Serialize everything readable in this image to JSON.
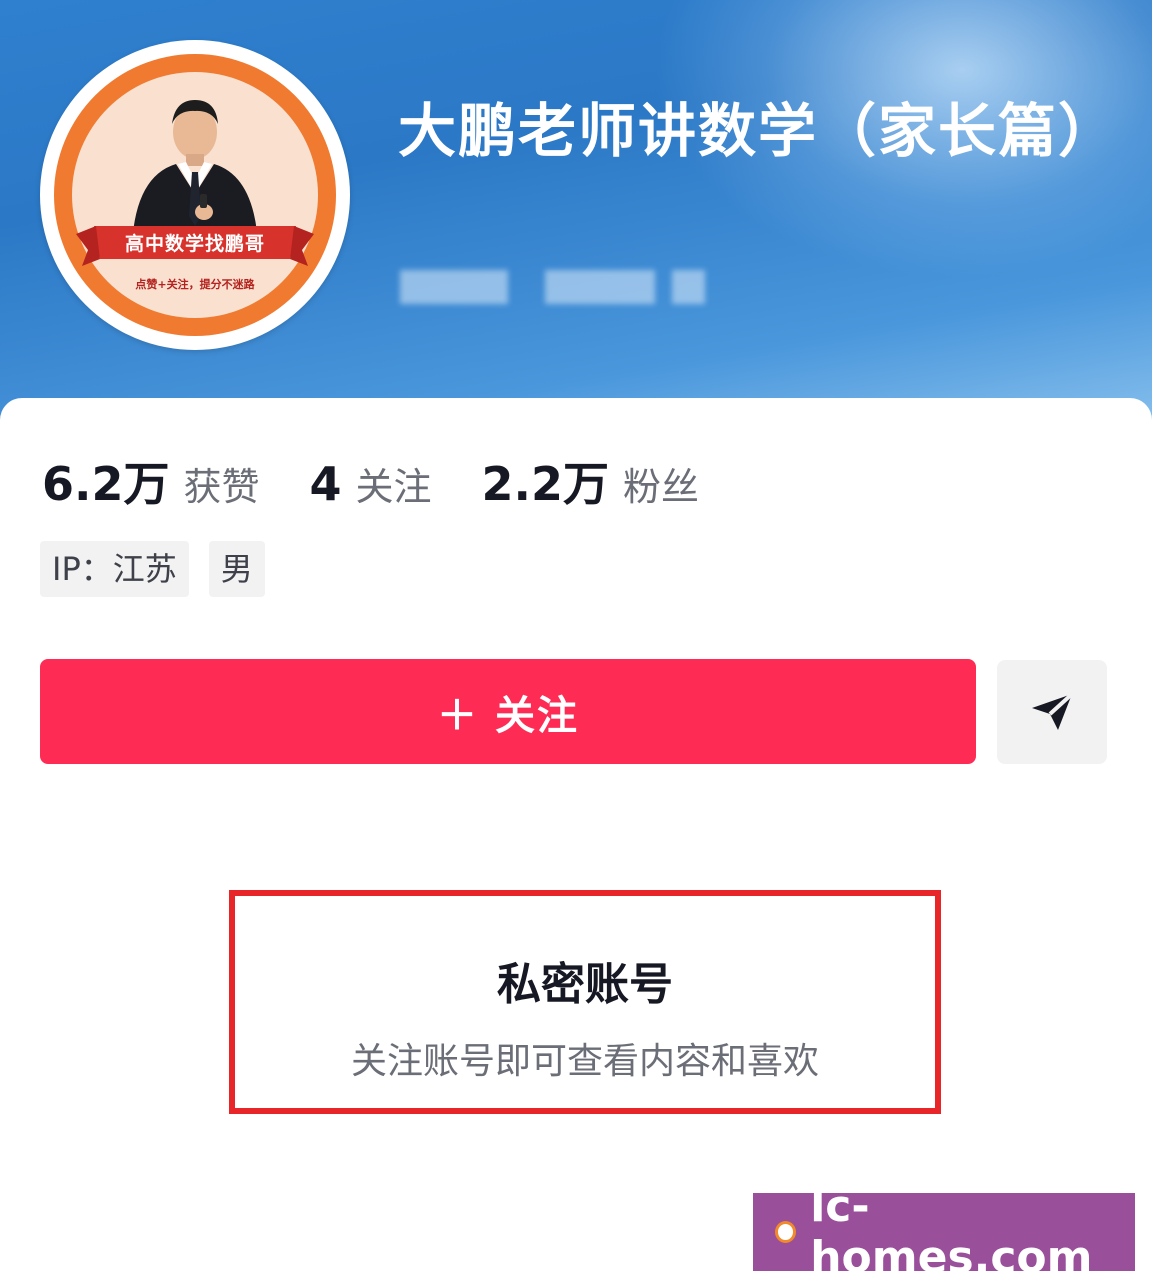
{
  "header": {
    "name": "大鹏老师讲数学（家长篇）",
    "avatar_banner_text": "高中数学找鹏哥",
    "avatar_sub_text": "点赞+关注，提分不迷路",
    "accent_color": "#2f80cf"
  },
  "stats": [
    {
      "value": "6.2万",
      "label": "获赞"
    },
    {
      "value": "4",
      "label": "关注"
    },
    {
      "value": "2.2万",
      "label": "粉丝"
    }
  ],
  "tags": [
    "IP：江苏",
    "男"
  ],
  "actions": {
    "follow_label": "＋ 关注",
    "follow_color": "#fe2c55",
    "share_icon": "send-icon"
  },
  "private_notice": {
    "title": "私密账号",
    "description": "关注账号即可查看内容和喜欢",
    "highlight_color": "#e8262a"
  },
  "watermark": {
    "text": "lc-homes.com",
    "background": "#9a4f9b"
  }
}
